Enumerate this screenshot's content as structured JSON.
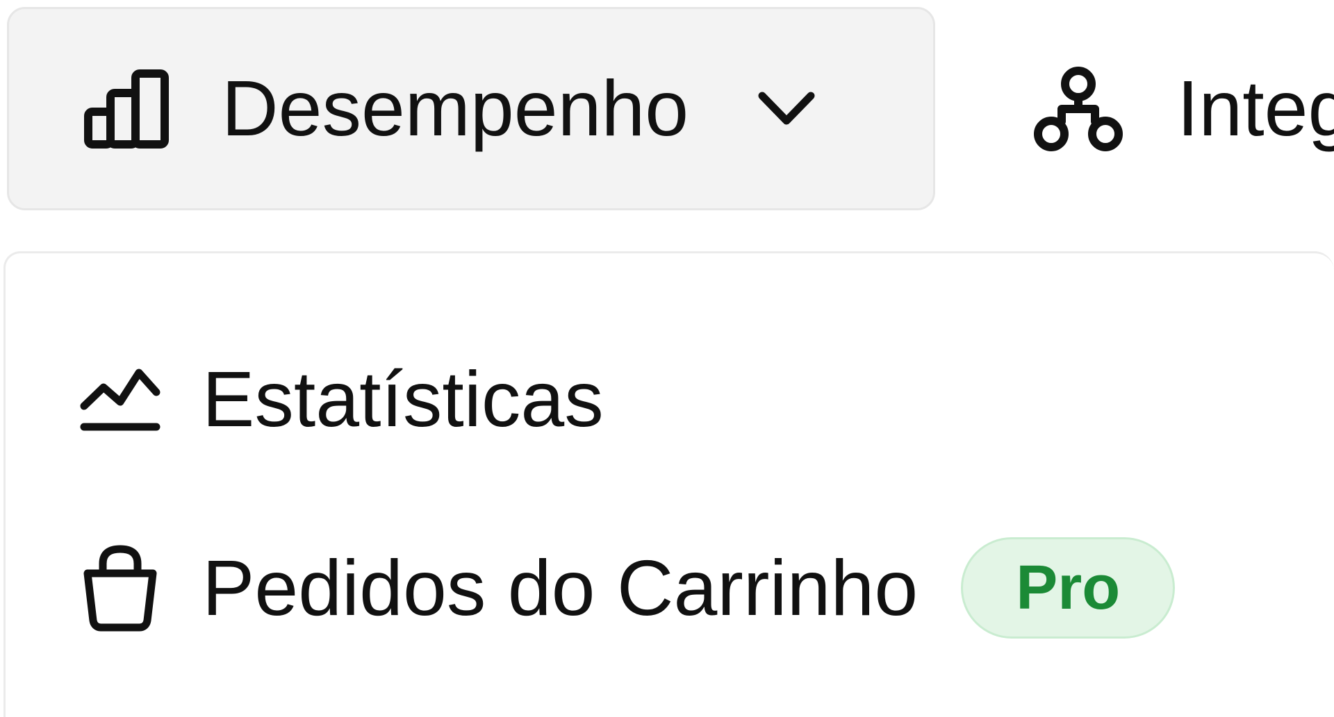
{
  "nav": {
    "performance": {
      "label": "Desempenho",
      "icon": "bar-chart-icon",
      "chevron_icon": "chevron-down-icon"
    },
    "integrations": {
      "label": "Integ",
      "icon": "integrations-icon"
    }
  },
  "dropdown": {
    "items": [
      {
        "label": "Estatísticas",
        "icon": "line-chart-icon"
      },
      {
        "label": "Pedidos do Carrinho",
        "icon": "shopping-bag-icon",
        "badge": "Pro"
      }
    ]
  },
  "colors": {
    "nav_active_bg": "#f3f3f3",
    "badge_bg": "#e3f5e6",
    "badge_text": "#1b8a36",
    "text": "#111111"
  }
}
